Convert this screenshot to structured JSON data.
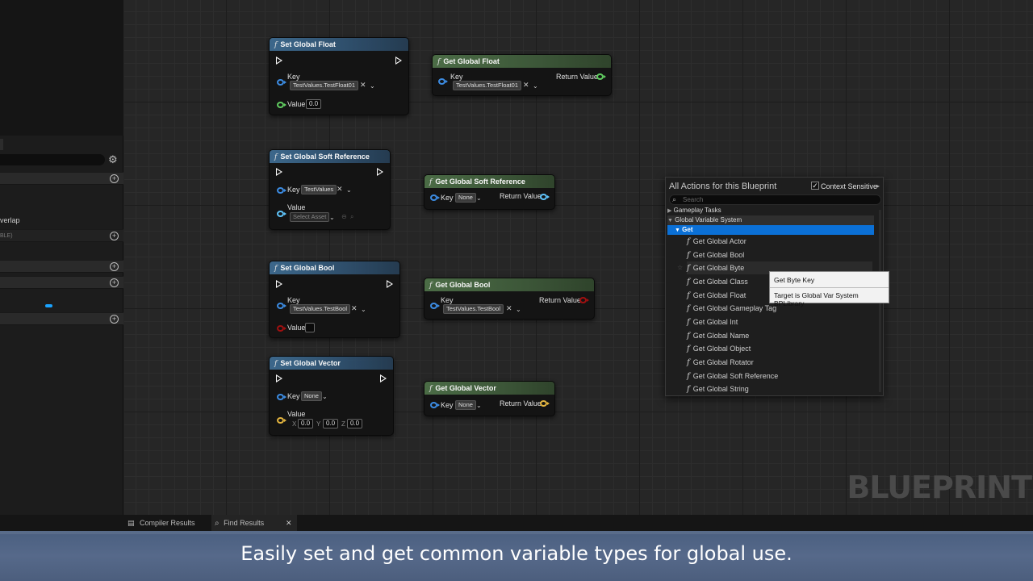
{
  "colors": {
    "set_header": "#2f4f6c",
    "get_header": "#3d5839",
    "menu_highlight": "#0b70d6",
    "caption_band": "#56698a",
    "pin_float": "#62d162",
    "pin_bool": "#a31010",
    "pin_vector": "#e8b840",
    "pin_key": "#3d8fe8"
  },
  "left_panel": {
    "overlap_text": "verlap",
    "variable_hint": "BLE)"
  },
  "nodes": {
    "set_float": {
      "title": "Set Global Float",
      "key_label": "Key",
      "key_value": "TestValues.TestFloat01",
      "value_label": "Value",
      "value": "0.0"
    },
    "get_float": {
      "title": "Get Global Float",
      "key_label": "Key",
      "key_value": "TestValues.TestFloat01",
      "return_label": "Return Value"
    },
    "set_soft": {
      "title": "Set Global Soft Reference",
      "key_label": "Key",
      "key_value": "TestValues",
      "value_label": "Value",
      "asset_placeholder": "Select Asset"
    },
    "get_soft": {
      "title": "Get Global Soft Reference",
      "key_label": "Key",
      "key_value": "None",
      "return_label": "Return Value"
    },
    "set_bool": {
      "title": "Set Global Bool",
      "key_label": "Key",
      "key_value": "TestValues.TestBool",
      "value_label": "Value"
    },
    "get_bool": {
      "title": "Get Global Bool",
      "key_label": "Key",
      "key_value": "TestValues.TestBool",
      "return_label": "Return Value"
    },
    "set_vector": {
      "title": "Set Global Vector",
      "key_label": "Key",
      "key_value": "None",
      "value_label": "Value",
      "x_label": "X",
      "x": "0.0",
      "y_label": "Y",
      "y": "0.0",
      "z_label": "Z",
      "z": "0.0"
    },
    "get_vector": {
      "title": "Get Global Vector",
      "key_label": "Key",
      "key_value": "None",
      "return_label": "Return Value"
    }
  },
  "action_menu": {
    "title": "All Actions for this Blueprint",
    "context_label": "Context Sensitive",
    "search_placeholder": "Search",
    "category_gameplay": "Gameplay Tasks",
    "category_global": "Global Variable System",
    "category_get": "Get",
    "items": [
      "Get Global Actor",
      "Get Global Bool",
      "Get Global Byte",
      "Get Global Class",
      "Get Global Float",
      "Get Global Gameplay Tag",
      "Get Global Int",
      "Get Global Name",
      "Get Global Object",
      "Get Global Rotator",
      "Get Global Soft Reference",
      "Get Global String"
    ]
  },
  "tooltip": {
    "title": "Get Byte Key",
    "body": "Target is Global Var System BPLibrary"
  },
  "bottom_tabs": {
    "compiler": "Compiler Results",
    "find": "Find Results"
  },
  "watermark": "BLUEPRINT",
  "caption": "Easily set and get common variable types for global use."
}
